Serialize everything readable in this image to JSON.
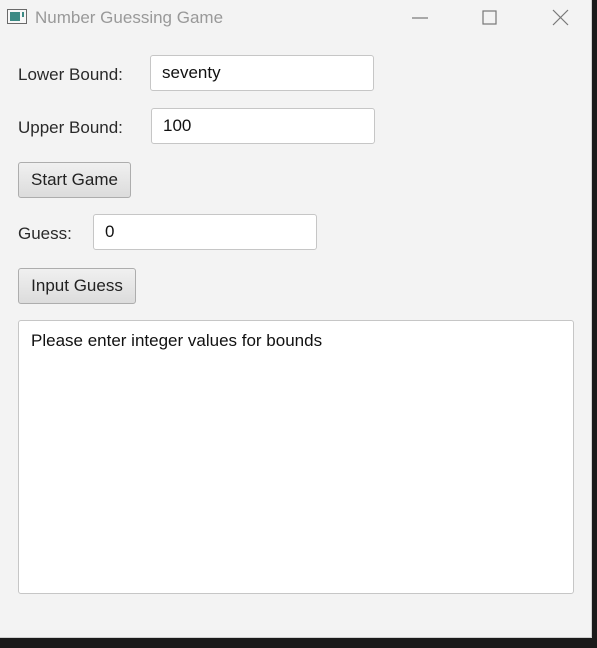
{
  "window": {
    "title": "Number Guessing Game",
    "icons": {
      "app": "app-window-icon",
      "minimize": "minimize-icon",
      "maximize": "maximize-icon",
      "close": "close-icon"
    }
  },
  "form": {
    "lower_bound": {
      "label": "Lower Bound:",
      "value": "seventy"
    },
    "upper_bound": {
      "label": "Upper Bound:",
      "value": "100"
    },
    "start_button": "Start Game",
    "guess": {
      "label": "Guess:",
      "value": "0"
    },
    "input_guess_button": "Input Guess"
  },
  "output": {
    "message": "Please enter integer values for bounds"
  }
}
